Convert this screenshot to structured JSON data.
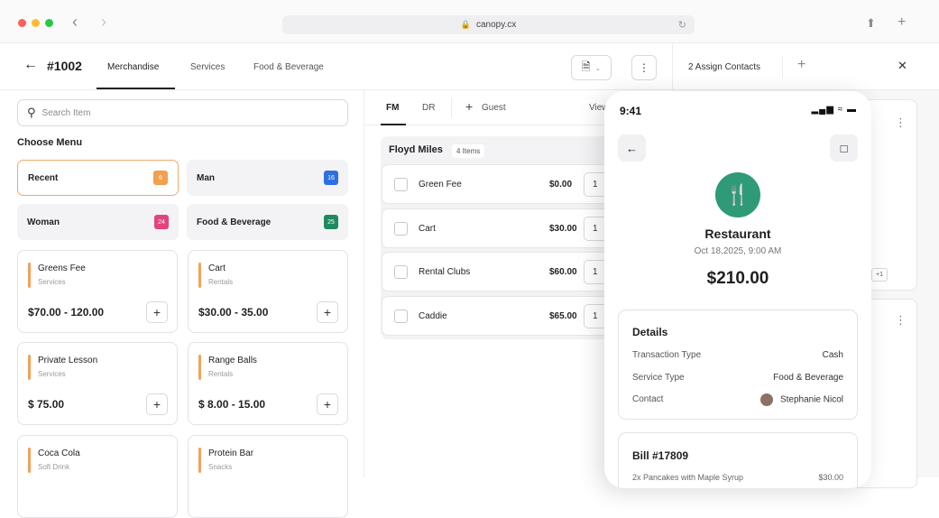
{
  "browser": {
    "url": "canopy.cx"
  },
  "topbar": {
    "order_id": "#1002",
    "tabs": [
      "Merchandise",
      "Services",
      "Food & Beverage"
    ],
    "assign_label": "2 Assign Contacts"
  },
  "search": {
    "placeholder": "Search Item"
  },
  "menu": {
    "heading": "Choose Menu",
    "categories": [
      {
        "label": "Recent",
        "count": "6",
        "color": "#f0a050"
      },
      {
        "label": "Man",
        "count": "16",
        "color": "#2f6fe4"
      },
      {
        "label": "Woman",
        "count": "24",
        "color": "#e0457b"
      },
      {
        "label": "Food & Beverage",
        "count": "25",
        "color": "#1f8a5f"
      }
    ],
    "items": [
      {
        "name": "Greens Fee",
        "category": "Services",
        "price": "$70.00 - 120.00"
      },
      {
        "name": "Cart",
        "category": "Rentals",
        "price": "$30.00 - 35.00"
      },
      {
        "name": "Private Lesson",
        "category": "Services",
        "price": "$ 75.00"
      },
      {
        "name": "Range Balls",
        "category": "Rentals",
        "price": "$ 8.00 - 15.00"
      },
      {
        "name": "Coca Cola",
        "category": "Soft Drink",
        "price": ""
      },
      {
        "name": "Protein Bar",
        "category": "Snacks",
        "price": ""
      }
    ]
  },
  "order": {
    "tabs": [
      "FM",
      "DR"
    ],
    "guest_label": "Guest",
    "view_label": "View",
    "group_name": "Floyd Miles",
    "group_count": "4 Items",
    "lines": [
      {
        "name": "Green Fee",
        "price": "$0.00",
        "qty": "1"
      },
      {
        "name": "Cart",
        "price": "$30.00",
        "qty": "1"
      },
      {
        "name": "Rental Clubs",
        "price": "$60.00",
        "qty": "1"
      },
      {
        "name": "Caddie",
        "price": "$65.00",
        "qty": "1"
      }
    ]
  },
  "contacts": {
    "more_tag": "+1"
  },
  "phone": {
    "time": "9:41",
    "merchant": "Restaurant",
    "date": "Oct 18,2025, 9:00 AM",
    "total": "$210.00",
    "details_title": "Details",
    "details": [
      {
        "key": "Transaction Type",
        "value": "Cash"
      },
      {
        "key": "Service Type",
        "value": "Food & Beverage"
      },
      {
        "key": "Contact",
        "value": "Stephanie Nicol"
      }
    ],
    "bill_title": "Bill #17809",
    "bill_line": "2x  Pancakes with Maple Syrup",
    "bill_line_price": "$30.00"
  }
}
